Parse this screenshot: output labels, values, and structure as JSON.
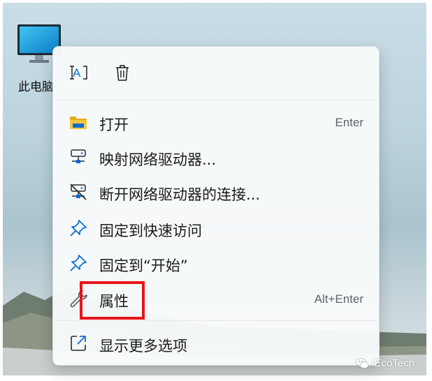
{
  "desktop": {
    "icon_label": "此电脑",
    "icon_name": "monitor-icon"
  },
  "toolbar": {
    "rename_icon": "rename-icon",
    "delete_icon": "trash-icon"
  },
  "menu": {
    "items": [
      {
        "label": "打开",
        "shortcut": "Enter",
        "icon": "folder-icon"
      },
      {
        "label": "映射网络驱动器...",
        "shortcut": "",
        "icon": "network-drive-icon"
      },
      {
        "label": "断开网络驱动器的连接...",
        "shortcut": "",
        "icon": "network-drive-disconnect-icon"
      },
      {
        "label": "固定到快速访问",
        "shortcut": "",
        "icon": "pin-icon"
      },
      {
        "label": "固定到“开始”",
        "shortcut": "",
        "icon": "pin-icon"
      },
      {
        "label": "属性",
        "shortcut": "Alt+Enter",
        "icon": "wrench-icon"
      },
      {
        "label": "显示更多选项",
        "shortcut": "",
        "icon": "share-icon"
      }
    ]
  },
  "watermark": {
    "text": "iEcoTech",
    "icon": "wechat-icon"
  },
  "colors": {
    "highlight": "#e8141a",
    "accent_blue": "#0a6ccf",
    "folder_yellow": "#f4c542"
  }
}
